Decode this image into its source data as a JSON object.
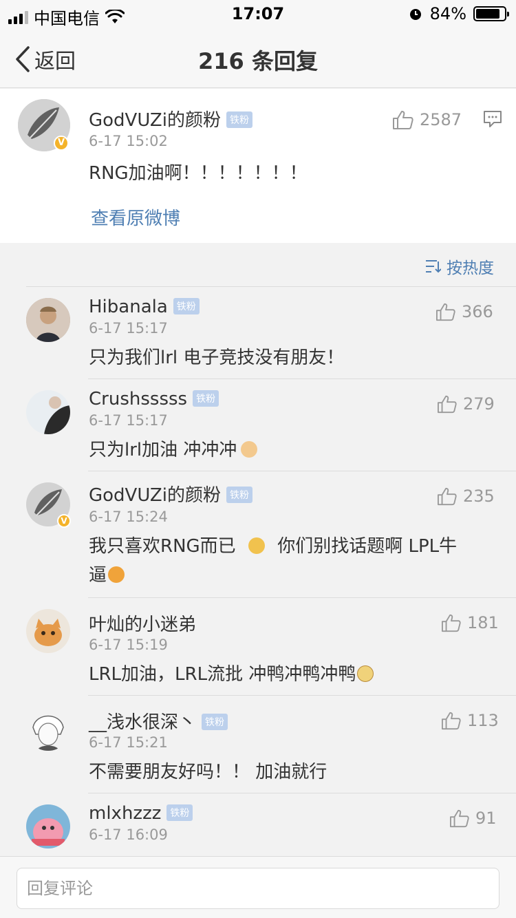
{
  "status_bar": {
    "carrier": "中国电信",
    "time": "17:07",
    "battery": "84%",
    "battery_level": 0.84
  },
  "nav": {
    "back_label": "返回",
    "title": "216 条回复"
  },
  "main_post": {
    "username": "GodVUZi的颜粉",
    "badge": "铁粉",
    "time": "6-17 15:02",
    "text": "RNG加油啊！！！！！！！",
    "likes": "2587",
    "link": "查看原微博"
  },
  "sort_label": "按热度",
  "comments": [
    {
      "username": "Hibanala",
      "badge": "铁粉",
      "time": "6-17 15:17",
      "text": "只为我们lrl 电子竞技没有朋友！",
      "likes": "366"
    },
    {
      "username": "Crushsssss",
      "badge": "铁粉",
      "time": "6-17 15:17",
      "text": "只为lrl加油 冲冲冲",
      "likes": "279"
    },
    {
      "username": "GodVUZi的颜粉",
      "badge": "铁粉",
      "time": "6-17 15:24",
      "text_a": "我只喜欢RNG而已",
      "text_b": "你们别找话题啊 LPL牛",
      "text_c": "逼",
      "likes": "235"
    },
    {
      "username": "叶灿的小迷弟",
      "badge": "",
      "time": "6-17 15:19",
      "text": "LRL加油，LRL流批 冲鸭冲鸭冲鸭",
      "likes": "181"
    },
    {
      "username": "__浅水很深丶",
      "badge": "铁粉",
      "time": "6-17 15:21",
      "text": "不需要朋友好吗！！ 加油就行",
      "likes": "113"
    },
    {
      "username": "mlxhzzz",
      "badge": "铁粉",
      "time": "6-17 16:09",
      "text": "",
      "likes": "91"
    }
  ],
  "reply_placeholder": "回复评论",
  "icons": [
    "back-chevron-icon",
    "thumb-up-icon",
    "comment-icon",
    "sort-icon",
    "verified-icon",
    "wifi-icon",
    "alarm-icon",
    "battery-icon"
  ],
  "colors": {
    "link": "#4f7fb3",
    "badge": "#bcd0ec",
    "verified": "#f4b32a"
  }
}
